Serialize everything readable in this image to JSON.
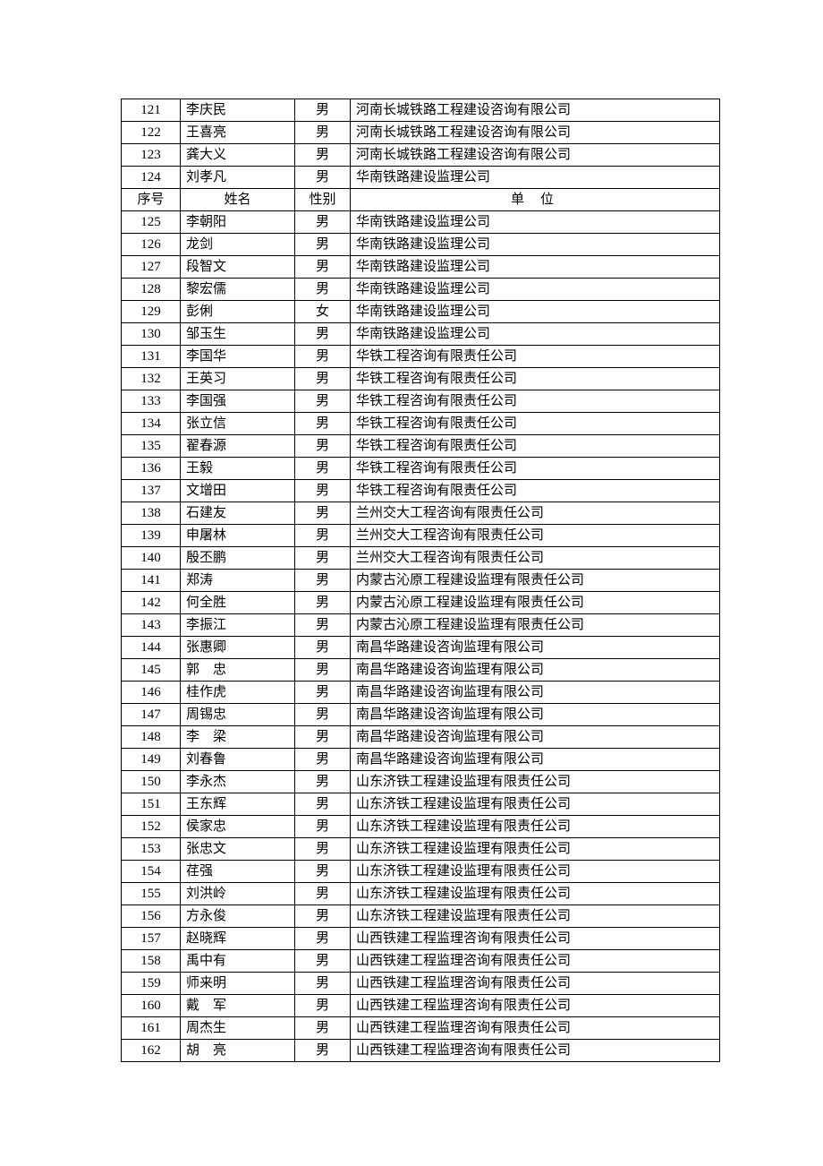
{
  "header": {
    "idx": "序号",
    "name": "姓名",
    "gender": "性别",
    "unit": "单位"
  },
  "rows": [
    {
      "idx": "121",
      "name": "李庆民",
      "gender": "男",
      "unit": "河南长城铁路工程建设咨询有限公司",
      "header": false
    },
    {
      "idx": "122",
      "name": "王喜亮",
      "gender": "男",
      "unit": "河南长城铁路工程建设咨询有限公司",
      "header": false
    },
    {
      "idx": "123",
      "name": "龚大义",
      "gender": "男",
      "unit": "河南长城铁路工程建设咨询有限公司",
      "header": false
    },
    {
      "idx": "124",
      "name": "刘孝凡",
      "gender": "男",
      "unit": "华南铁路建设监理公司",
      "header": false
    },
    {
      "header": true
    },
    {
      "idx": "125",
      "name": "李朝阳",
      "gender": "男",
      "unit": "华南铁路建设监理公司",
      "header": false
    },
    {
      "idx": "126",
      "name": "龙剑",
      "gender": "男",
      "unit": "华南铁路建设监理公司",
      "header": false
    },
    {
      "idx": "127",
      "name": "段智文",
      "gender": "男",
      "unit": "华南铁路建设监理公司",
      "header": false
    },
    {
      "idx": "128",
      "name": "黎宏儒",
      "gender": "男",
      "unit": "华南铁路建设监理公司",
      "header": false
    },
    {
      "idx": "129",
      "name": "彭俐",
      "gender": "女",
      "unit": "华南铁路建设监理公司",
      "header": false
    },
    {
      "idx": "130",
      "name": "邹玉生",
      "gender": "男",
      "unit": "华南铁路建设监理公司",
      "header": false
    },
    {
      "idx": "131",
      "name": "李国华",
      "gender": "男",
      "unit": "华铁工程咨询有限责任公司",
      "header": false
    },
    {
      "idx": "132",
      "name": "王英习",
      "gender": "男",
      "unit": "华铁工程咨询有限责任公司",
      "header": false
    },
    {
      "idx": "133",
      "name": "李国强",
      "gender": "男",
      "unit": "华铁工程咨询有限责任公司",
      "header": false
    },
    {
      "idx": "134",
      "name": "张立信",
      "gender": "男",
      "unit": "华铁工程咨询有限责任公司",
      "header": false
    },
    {
      "idx": "135",
      "name": "翟春源",
      "gender": "男",
      "unit": "华铁工程咨询有限责任公司",
      "header": false
    },
    {
      "idx": "136",
      "name": "王毅",
      "gender": "男",
      "unit": "华铁工程咨询有限责任公司",
      "header": false
    },
    {
      "idx": "137",
      "name": "文增田",
      "gender": "男",
      "unit": "华铁工程咨询有限责任公司",
      "header": false
    },
    {
      "idx": "138",
      "name": "石建友",
      "gender": "男",
      "unit": "兰州交大工程咨询有限责任公司",
      "header": false
    },
    {
      "idx": "139",
      "name": "申屠林",
      "gender": "男",
      "unit": "兰州交大工程咨询有限责任公司",
      "header": false
    },
    {
      "idx": "140",
      "name": "殷丕鹏",
      "gender": "男",
      "unit": "兰州交大工程咨询有限责任公司",
      "header": false
    },
    {
      "idx": "141",
      "name": "郑涛",
      "gender": "男",
      "unit": "内蒙古沁原工程建设监理有限责任公司",
      "header": false
    },
    {
      "idx": "142",
      "name": "何全胜",
      "gender": "男",
      "unit": "内蒙古沁原工程建设监理有限责任公司",
      "header": false
    },
    {
      "idx": "143",
      "name": "李振江",
      "gender": "男",
      "unit": "内蒙古沁原工程建设监理有限责任公司",
      "header": false
    },
    {
      "idx": "144",
      "name": "张惠卿",
      "gender": "男",
      "unit": "南昌华路建设咨询监理有限公司",
      "header": false
    },
    {
      "idx": "145",
      "name": "郭　忠",
      "gender": "男",
      "unit": "南昌华路建设咨询监理有限公司",
      "header": false
    },
    {
      "idx": "146",
      "name": "桂作虎",
      "gender": "男",
      "unit": "南昌华路建设咨询监理有限公司",
      "header": false
    },
    {
      "idx": "147",
      "name": "周锡忠",
      "gender": "男",
      "unit": "南昌华路建设咨询监理有限公司",
      "header": false
    },
    {
      "idx": "148",
      "name": "李　梁",
      "gender": "男",
      "unit": "南昌华路建设咨询监理有限公司",
      "header": false
    },
    {
      "idx": "149",
      "name": "刘春鲁",
      "gender": "男",
      "unit": "南昌华路建设咨询监理有限公司",
      "header": false
    },
    {
      "idx": "150",
      "name": "李永杰",
      "gender": "男",
      "unit": "山东济铁工程建设监理有限责任公司",
      "header": false
    },
    {
      "idx": "151",
      "name": "王东辉",
      "gender": "男",
      "unit": "山东济铁工程建设监理有限责任公司",
      "header": false
    },
    {
      "idx": "152",
      "name": "侯家忠",
      "gender": "男",
      "unit": "山东济铁工程建设监理有限责任公司",
      "header": false
    },
    {
      "idx": "153",
      "name": "张忠文",
      "gender": "男",
      "unit": "山东济铁工程建设监理有限责任公司",
      "header": false
    },
    {
      "idx": "154",
      "name": "荏强",
      "gender": "男",
      "unit": "山东济铁工程建设监理有限责任公司",
      "header": false
    },
    {
      "idx": "155",
      "name": "刘洪岭",
      "gender": "男",
      "unit": "山东济铁工程建设监理有限责任公司",
      "header": false
    },
    {
      "idx": "156",
      "name": "方永俊",
      "gender": "男",
      "unit": "山东济铁工程建设监理有限责任公司",
      "header": false
    },
    {
      "idx": "157",
      "name": "赵晓辉",
      "gender": "男",
      "unit": "山西铁建工程监理咨询有限责任公司",
      "header": false
    },
    {
      "idx": "158",
      "name": "禹中有",
      "gender": "男",
      "unit": "山西铁建工程监理咨询有限责任公司",
      "header": false
    },
    {
      "idx": "159",
      "name": "师来明",
      "gender": "男",
      "unit": "山西铁建工程监理咨询有限责任公司",
      "header": false
    },
    {
      "idx": "160",
      "name": "戴　军",
      "gender": "男",
      "unit": "山西铁建工程监理咨询有限责任公司",
      "header": false
    },
    {
      "idx": "161",
      "name": "周杰生",
      "gender": "男",
      "unit": "山西铁建工程监理咨询有限责任公司",
      "header": false
    },
    {
      "idx": "162",
      "name": "胡　亮",
      "gender": "男",
      "unit": "山西铁建工程监理咨询有限责任公司",
      "header": false
    }
  ]
}
